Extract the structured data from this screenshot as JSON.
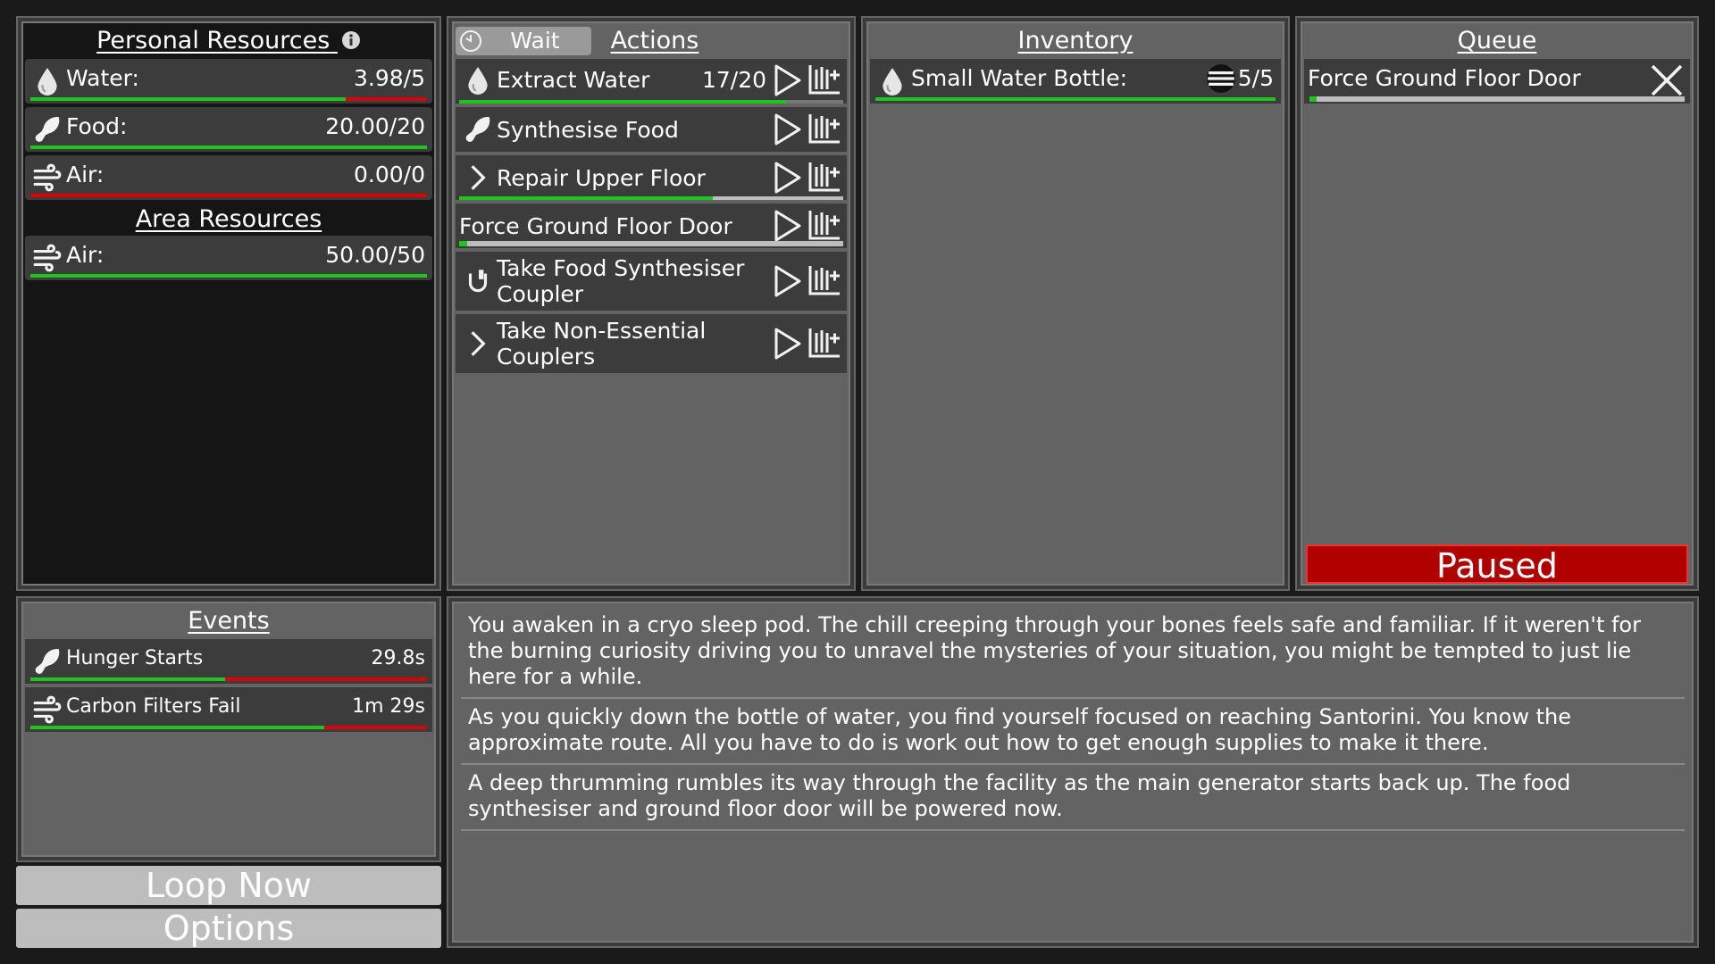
{
  "personal": {
    "title": "Personal Resources",
    "items": [
      {
        "icon": "water-drop-icon",
        "label": "Water:",
        "value": "3.98/5",
        "fill": 0.796
      },
      {
        "icon": "food-leg-icon",
        "label": "Food:",
        "value": "20.00/20",
        "fill": 1.0
      },
      {
        "icon": "air-wind-icon",
        "label": "Air:",
        "value": "0.00/0",
        "fill": 0.0
      }
    ]
  },
  "area": {
    "title": "Area Resources",
    "items": [
      {
        "icon": "air-wind-icon",
        "label": "Air:",
        "value": "50.00/50",
        "fill": 1.0
      }
    ]
  },
  "actions": {
    "wait_label": "Wait",
    "title": "Actions",
    "items": [
      {
        "icon": "water-drop-icon",
        "label": "Extract Water",
        "count": "17/20",
        "progress": 0.85,
        "bar": "green"
      },
      {
        "icon": "food-leg-icon",
        "label": "Synthesise Food",
        "count": "",
        "progress": 0,
        "bar": "none"
      },
      {
        "icon": "chevron-right-icon",
        "label": "Repair Upper Floor",
        "count": "",
        "progress": 0.66,
        "bar": "grey"
      },
      {
        "icon": "",
        "label": "Force Ground Floor Door",
        "count": "",
        "progress": 0.02,
        "bar": "grey"
      },
      {
        "icon": "plug-icon",
        "label": "Take Food Synthesiser Coupler",
        "line1": "Take Food Synthesiser",
        "line2": "Coupler",
        "count": "",
        "progress": 0,
        "bar": "none"
      },
      {
        "icon": "chevron-right-icon",
        "label": "Take Non-Essential Couplers",
        "line1": "Take Non-Essential",
        "line2": "Couplers",
        "count": "",
        "progress": 0,
        "bar": "none"
      }
    ]
  },
  "inventory": {
    "title": "Inventory",
    "items": [
      {
        "icon": "water-drop-icon",
        "label": "Small Water Bottle:",
        "value": "5/5",
        "fill": 1.0
      }
    ]
  },
  "queue": {
    "title": "Queue",
    "items": [
      {
        "label": "Force Ground Floor Door",
        "progress": 0.02
      }
    ],
    "status": "Paused"
  },
  "events": {
    "title": "Events",
    "items": [
      {
        "icon": "food-leg-icon",
        "label": "Hunger Starts",
        "value": "29.8s",
        "fill": 0.49
      },
      {
        "icon": "air-wind-icon",
        "label": "Carbon Filters Fail",
        "value": "1m 29s",
        "fill": 0.74
      }
    ]
  },
  "buttons": {
    "loop_now": "Loop Now",
    "options": "Options"
  },
  "log": [
    "You awaken in a cryo sleep pod. The chill creeping through your bones feels safe and familiar. If it weren't for the burning curiosity driving you to unravel the mysteries of your situation, you might be tempted to just lie here for a while.",
    "As you quickly down the bottle of water, you find yourself focused on reaching Santorini. You know the approximate route. All you have to do is work out how to get enough supplies to make it there.",
    "A deep thrumming rumbles its way through the facility as the main generator starts back up. The food synthesiser and ground floor door will be powered now."
  ],
  "colors": {
    "bar_full": "#1fc41f",
    "bar_empty": "#dd0000",
    "paused_bg": "#b00000"
  }
}
